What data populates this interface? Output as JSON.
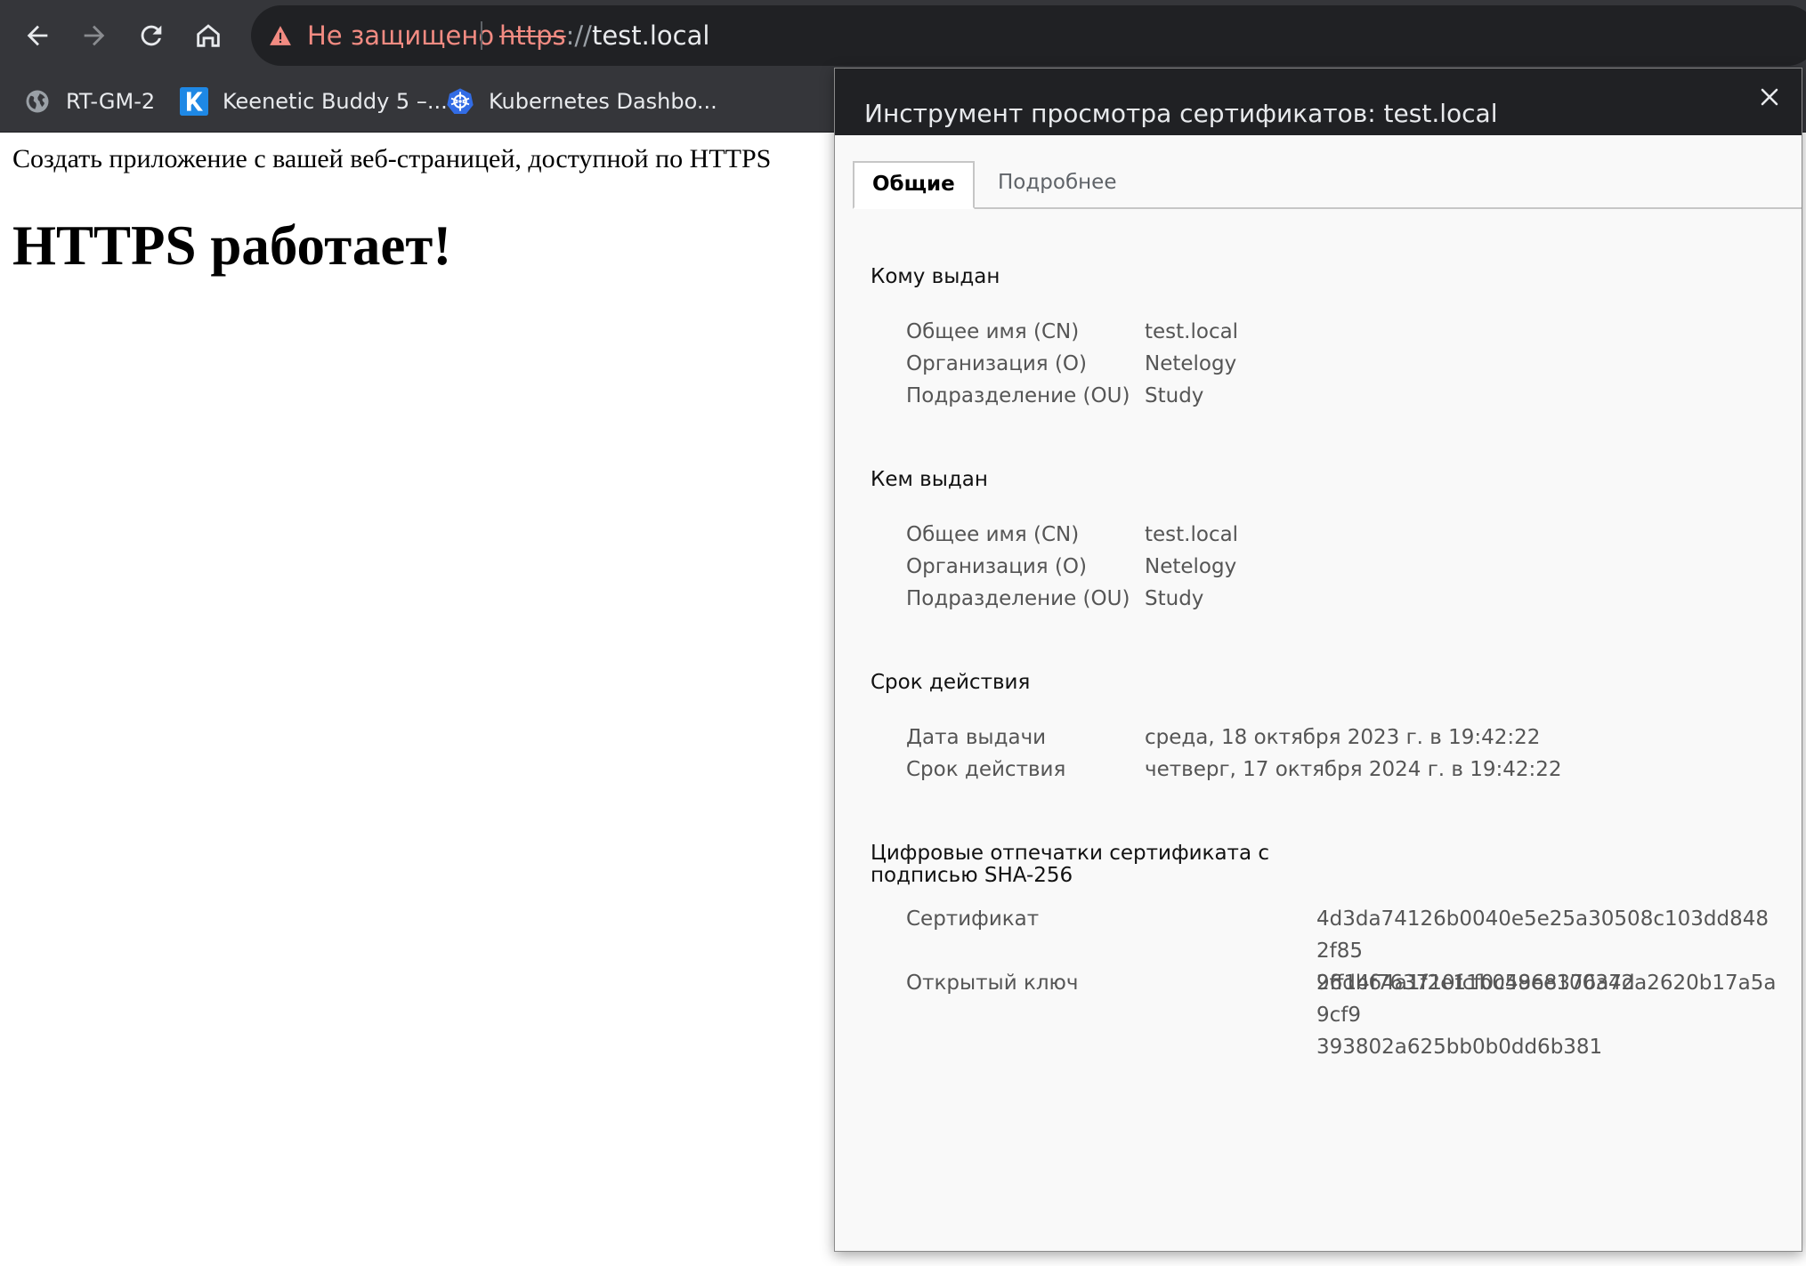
{
  "toolbar": {
    "security_label": "Не защищено",
    "url_scheme": "https",
    "url_slashes": "://",
    "url_host": "test.local"
  },
  "bookmarks": [
    {
      "label": "RT-GM-2",
      "icon": "globe-icon"
    },
    {
      "label": "Keenetic Buddy 5 –...",
      "icon": "keenetic-logo-icon"
    },
    {
      "label": "Kubernetes Dashbo...",
      "icon": "kubernetes-logo-icon"
    }
  ],
  "page": {
    "text": "Создать приложение с вашей веб-страницей, доступной по HTTPS",
    "heading": "HTTPS работает!"
  },
  "cert_viewer": {
    "title": "Инструмент просмотра сертификатов: test.local",
    "tabs": [
      "Общие",
      "Подробнее"
    ],
    "issued_to": {
      "title": "Кому выдан",
      "rows": [
        {
          "label": "Общее имя (CN)",
          "value": "test.local"
        },
        {
          "label": "Организация (O)",
          "value": "Netelogy"
        },
        {
          "label": "Подразделение (OU)",
          "value": "Study"
        }
      ]
    },
    "issued_by": {
      "title": "Кем выдан",
      "rows": [
        {
          "label": "Общее имя (CN)",
          "value": "test.local"
        },
        {
          "label": "Организация (O)",
          "value": "Netelogy"
        },
        {
          "label": "Подразделение (OU)",
          "value": "Study"
        }
      ]
    },
    "validity": {
      "title": "Срок действия",
      "rows": [
        {
          "label": "Дата выдачи",
          "value": "среда, 18 октября 2023 г. в 19:42:22"
        },
        {
          "label": "Срок действия",
          "value": "четверг, 17 октября 2024 г. в 19:42:22"
        }
      ]
    },
    "fingerprints": {
      "title_line1": "Цифровые отпечатки сертификата с",
      "title_line2": "подписью SHA-256",
      "rows": [
        {
          "label": "Сертификат",
          "value_line1": "4d3da74126b0040e5e25a30508c103dd8482f85",
          "value_line2": "26db64a1f2e11b04968376a7d"
        },
        {
          "label": "Открытый ключ",
          "value_line1": "9ff14f763710fcf0c58ee100342a2620b17a5a9cf9",
          "value_line2": "393802a625bb0b0dd6b381"
        }
      ]
    }
  },
  "colors": {
    "chrome_bg": "#35363a",
    "omnibox_bg": "#202124",
    "warning_red": "#f28b82",
    "dialog_bg": "#f9f9f9"
  }
}
